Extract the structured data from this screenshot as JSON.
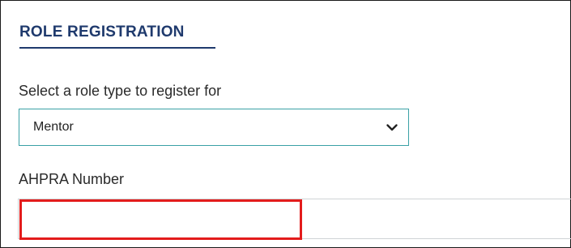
{
  "form": {
    "title": "ROLE REGISTRATION",
    "role_select": {
      "label": "Select a role type to register for",
      "value": "Mentor",
      "icon": "chevron-down-icon"
    },
    "ahpra": {
      "label": "AHPRA Number",
      "value": "",
      "placeholder": ""
    }
  },
  "colors": {
    "title": "#1f3a6d",
    "select_border": "#3aa1a6",
    "highlight": "#e31c1c",
    "field_border": "#cfd3d6"
  }
}
